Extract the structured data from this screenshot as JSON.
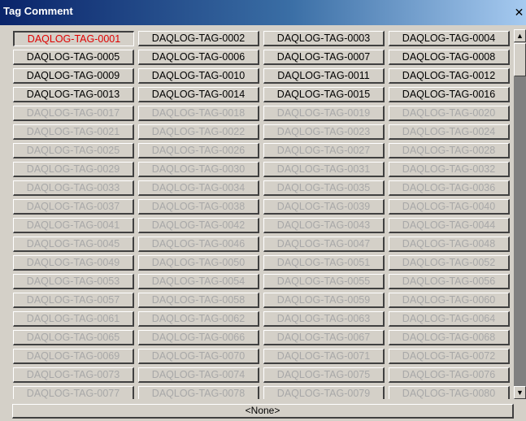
{
  "window": {
    "title": "Tag Comment",
    "close_glyph": "✕"
  },
  "grid": {
    "columns": 4,
    "active_tag": "DAQLOG-TAG-0001",
    "enabled_count": 16,
    "tags": [
      "DAQLOG-TAG-0001",
      "DAQLOG-TAG-0002",
      "DAQLOG-TAG-0003",
      "DAQLOG-TAG-0004",
      "DAQLOG-TAG-0005",
      "DAQLOG-TAG-0006",
      "DAQLOG-TAG-0007",
      "DAQLOG-TAG-0008",
      "DAQLOG-TAG-0009",
      "DAQLOG-TAG-0010",
      "DAQLOG-TAG-0011",
      "DAQLOG-TAG-0012",
      "DAQLOG-TAG-0013",
      "DAQLOG-TAG-0014",
      "DAQLOG-TAG-0015",
      "DAQLOG-TAG-0016",
      "DAQLOG-TAG-0017",
      "DAQLOG-TAG-0018",
      "DAQLOG-TAG-0019",
      "DAQLOG-TAG-0020",
      "DAQLOG-TAG-0021",
      "DAQLOG-TAG-0022",
      "DAQLOG-TAG-0023",
      "DAQLOG-TAG-0024",
      "DAQLOG-TAG-0025",
      "DAQLOG-TAG-0026",
      "DAQLOG-TAG-0027",
      "DAQLOG-TAG-0028",
      "DAQLOG-TAG-0029",
      "DAQLOG-TAG-0030",
      "DAQLOG-TAG-0031",
      "DAQLOG-TAG-0032",
      "DAQLOG-TAG-0033",
      "DAQLOG-TAG-0034",
      "DAQLOG-TAG-0035",
      "DAQLOG-TAG-0036",
      "DAQLOG-TAG-0037",
      "DAQLOG-TAG-0038",
      "DAQLOG-TAG-0039",
      "DAQLOG-TAG-0040",
      "DAQLOG-TAG-0041",
      "DAQLOG-TAG-0042",
      "DAQLOG-TAG-0043",
      "DAQLOG-TAG-0044",
      "DAQLOG-TAG-0045",
      "DAQLOG-TAG-0046",
      "DAQLOG-TAG-0047",
      "DAQLOG-TAG-0048",
      "DAQLOG-TAG-0049",
      "DAQLOG-TAG-0050",
      "DAQLOG-TAG-0051",
      "DAQLOG-TAG-0052",
      "DAQLOG-TAG-0053",
      "DAQLOG-TAG-0054",
      "DAQLOG-TAG-0055",
      "DAQLOG-TAG-0056",
      "DAQLOG-TAG-0057",
      "DAQLOG-TAG-0058",
      "DAQLOG-TAG-0059",
      "DAQLOG-TAG-0060",
      "DAQLOG-TAG-0061",
      "DAQLOG-TAG-0062",
      "DAQLOG-TAG-0063",
      "DAQLOG-TAG-0064",
      "DAQLOG-TAG-0065",
      "DAQLOG-TAG-0066",
      "DAQLOG-TAG-0067",
      "DAQLOG-TAG-0068",
      "DAQLOG-TAG-0069",
      "DAQLOG-TAG-0070",
      "DAQLOG-TAG-0071",
      "DAQLOG-TAG-0072",
      "DAQLOG-TAG-0073",
      "DAQLOG-TAG-0074",
      "DAQLOG-TAG-0075",
      "DAQLOG-TAG-0076",
      "DAQLOG-TAG-0077",
      "DAQLOG-TAG-0078",
      "DAQLOG-TAG-0079",
      "DAQLOG-TAG-0080"
    ]
  },
  "scrollbar": {
    "up_glyph": "▲",
    "down_glyph": "▼"
  },
  "status": {
    "selected_comment": "<None>"
  },
  "colors": {
    "title_bar": "#0a246a",
    "active_text": "#e00000",
    "disabled_text": "#a8a8a8",
    "face": "#d4d0c8"
  }
}
